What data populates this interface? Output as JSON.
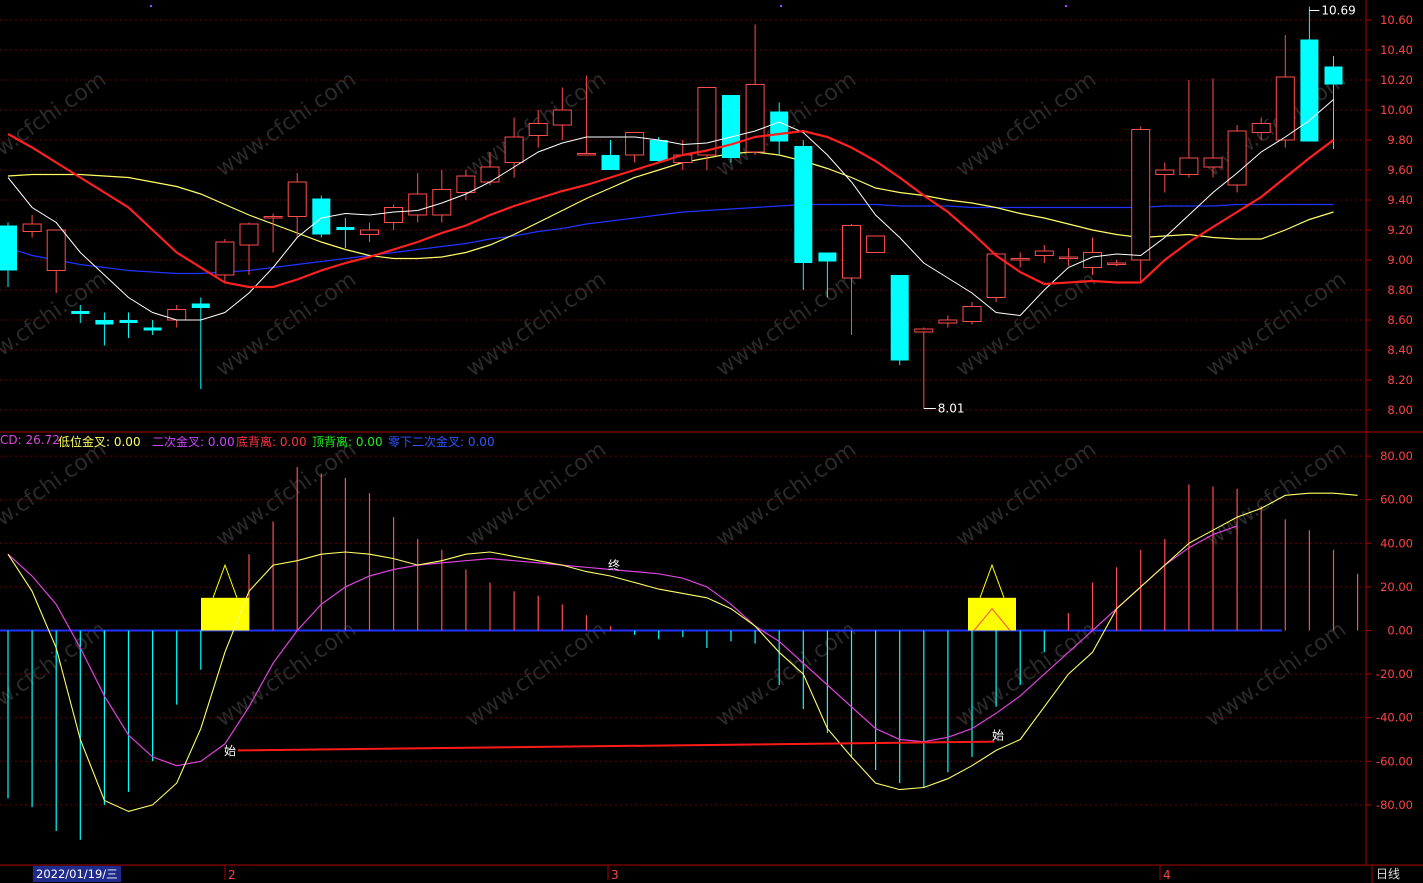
{
  "indicator": {
    "macd_label": "CD: 26.72",
    "low_cross_label": "低位金叉: 0.00",
    "second_cross_label": "二次金叉: 0.00",
    "bottom_div_label": "底背离: 0.00",
    "top_div_label": "顶背离: 0.00",
    "zero_second_cross_label": "零下二次金叉: 0.00"
  },
  "footer": {
    "date": "2022/01/19/三",
    "period": "日线",
    "month_labels": [
      "2",
      "3",
      "4"
    ]
  },
  "annotations": {
    "high": "10.69",
    "low": "8.01",
    "start": "始",
    "end": "终"
  },
  "watermark": "www.cfchi.com",
  "colors": {
    "up": "#ff4d4d",
    "down": "#00ffff",
    "ma5": "#ffffff",
    "ma10": "#ff2020",
    "ma20": "#ffff66",
    "ma60": "#2233ff",
    "dif": "#ffff66",
    "dea": "#dd44dd",
    "axis": "#aa0000",
    "signal": "#ffff00"
  },
  "chart_data": [
    {
      "type": "candlestick",
      "ylim": [
        7.95,
        10.72
      ],
      "yticks": [
        8.0,
        8.2,
        8.4,
        8.6,
        8.8,
        9.0,
        9.2,
        9.4,
        9.6,
        9.8,
        10.0,
        10.2,
        10.4,
        10.6
      ],
      "ohlc": [
        [
          9.23,
          9.25,
          8.82,
          8.93
        ],
        [
          9.19,
          9.3,
          9.15,
          9.24
        ],
        [
          8.93,
          9.2,
          8.78,
          9.2
        ],
        [
          8.66,
          8.7,
          8.58,
          8.65
        ],
        [
          8.6,
          8.65,
          8.43,
          8.57
        ],
        [
          8.6,
          8.65,
          8.48,
          8.58
        ],
        [
          8.55,
          8.6,
          8.5,
          8.53
        ],
        [
          8.6,
          8.7,
          8.55,
          8.67
        ],
        [
          8.71,
          8.75,
          8.14,
          8.68
        ],
        [
          8.9,
          9.14,
          8.85,
          9.12
        ],
        [
          9.1,
          9.25,
          8.9,
          9.24
        ],
        [
          9.28,
          9.31,
          9.05,
          9.29
        ],
        [
          9.29,
          9.58,
          9.15,
          9.52
        ],
        [
          9.41,
          9.43,
          9.15,
          9.17
        ],
        [
          9.22,
          9.28,
          9.08,
          9.2
        ],
        [
          9.17,
          9.25,
          9.12,
          9.2
        ],
        [
          9.25,
          9.37,
          9.2,
          9.35
        ],
        [
          9.3,
          9.58,
          9.25,
          9.44
        ],
        [
          9.3,
          9.6,
          9.25,
          9.47
        ],
        [
          9.45,
          9.6,
          9.4,
          9.56
        ],
        [
          9.52,
          9.72,
          9.5,
          9.62
        ],
        [
          9.65,
          9.95,
          9.55,
          9.82
        ],
        [
          9.83,
          10.0,
          9.75,
          9.91
        ],
        [
          9.9,
          10.15,
          9.8,
          10.0
        ],
        [
          9.71,
          10.23,
          9.7,
          9.71
        ],
        [
          9.7,
          9.8,
          9.6,
          9.6
        ],
        [
          9.7,
          9.8,
          9.65,
          9.85
        ],
        [
          9.8,
          9.82,
          9.65,
          9.66
        ],
        [
          9.65,
          9.8,
          9.6,
          9.7
        ],
        [
          9.7,
          10.12,
          9.6,
          10.15
        ],
        [
          10.1,
          10.1,
          9.65,
          9.68
        ],
        [
          9.72,
          10.57,
          9.7,
          10.17
        ],
        [
          9.99,
          10.05,
          9.7,
          9.79
        ],
        [
          9.76,
          9.8,
          8.8,
          8.98
        ],
        [
          9.05,
          9.05,
          8.75,
          8.99
        ],
        [
          8.88,
          9.24,
          8.5,
          9.23
        ],
        [
          9.05,
          9.15,
          9.05,
          9.16
        ],
        [
          8.9,
          8.9,
          8.3,
          8.33
        ],
        [
          8.52,
          8.55,
          8.01,
          8.54
        ],
        [
          8.58,
          8.63,
          8.55,
          8.6
        ],
        [
          8.59,
          8.72,
          8.57,
          8.69
        ],
        [
          8.75,
          9.05,
          8.72,
          9.04
        ],
        [
          9.0,
          9.05,
          8.95,
          9.01
        ],
        [
          9.03,
          9.1,
          8.98,
          9.06
        ],
        [
          9.01,
          9.08,
          8.96,
          9.02
        ],
        [
          8.95,
          9.15,
          8.9,
          9.05
        ],
        [
          8.98,
          9.0,
          8.96,
          8.98
        ],
        [
          9.0,
          9.89,
          8.85,
          9.87
        ],
        [
          9.57,
          9.65,
          9.45,
          9.6
        ],
        [
          9.57,
          10.2,
          9.55,
          9.68
        ],
        [
          9.62,
          10.21,
          9.55,
          9.68
        ],
        [
          9.5,
          9.9,
          9.45,
          9.86
        ],
        [
          9.85,
          9.95,
          9.8,
          9.91
        ],
        [
          9.8,
          10.5,
          9.75,
          10.22
        ],
        [
          10.47,
          10.69,
          9.8,
          9.79
        ],
        [
          10.29,
          10.36,
          9.74,
          10.17
        ]
      ],
      "ma5": [
        9.55,
        9.35,
        9.25,
        9.05,
        8.9,
        8.75,
        8.65,
        8.6,
        8.6,
        8.65,
        8.78,
        8.95,
        9.15,
        9.28,
        9.31,
        9.3,
        9.32,
        9.33,
        9.38,
        9.44,
        9.52,
        9.62,
        9.72,
        9.78,
        9.82,
        9.82,
        9.82,
        9.8,
        9.77,
        9.78,
        9.82,
        9.86,
        9.92,
        9.85,
        9.7,
        9.52,
        9.3,
        9.15,
        8.98,
        8.88,
        8.78,
        8.65,
        8.63,
        8.8,
        8.95,
        9.02,
        9.04,
        9.03,
        9.15,
        9.3,
        9.45,
        9.58,
        9.72,
        9.82,
        9.93,
        10.07
      ],
      "ma10": [
        9.84,
        9.75,
        9.65,
        9.55,
        9.45,
        9.35,
        9.2,
        9.05,
        8.95,
        8.85,
        8.82,
        8.82,
        8.87,
        8.93,
        8.98,
        9.02,
        9.07,
        9.12,
        9.18,
        9.23,
        9.3,
        9.36,
        9.41,
        9.46,
        9.5,
        9.55,
        9.6,
        9.65,
        9.7,
        9.73,
        9.77,
        9.82,
        9.84,
        9.86,
        9.82,
        9.75,
        9.66,
        9.55,
        9.43,
        9.32,
        9.18,
        9.03,
        8.92,
        8.84,
        8.85,
        8.86,
        8.85,
        8.85,
        9.0,
        9.12,
        9.22,
        9.32,
        9.42,
        9.55,
        9.68,
        9.8
      ],
      "ma20": [
        9.56,
        9.57,
        9.57,
        9.57,
        9.56,
        9.55,
        9.52,
        9.49,
        9.44,
        9.37,
        9.3,
        9.24,
        9.18,
        9.12,
        9.07,
        9.03,
        9.01,
        9.01,
        9.02,
        9.05,
        9.1,
        9.17,
        9.25,
        9.33,
        9.41,
        9.48,
        9.55,
        9.6,
        9.65,
        9.68,
        9.71,
        9.72,
        9.7,
        9.66,
        9.61,
        9.55,
        9.48,
        9.45,
        9.43,
        9.4,
        9.38,
        9.35,
        9.31,
        9.28,
        9.24,
        9.2,
        9.17,
        9.15,
        9.16,
        9.17,
        9.15,
        9.14,
        9.14,
        9.2,
        9.27,
        9.32
      ],
      "ma60": [
        9.08,
        9.03,
        9.0,
        8.97,
        8.95,
        8.93,
        8.92,
        8.91,
        8.91,
        8.92,
        8.93,
        8.95,
        8.97,
        8.99,
        9.01,
        9.03,
        9.05,
        9.07,
        9.09,
        9.11,
        9.14,
        9.16,
        9.19,
        9.21,
        9.24,
        9.26,
        9.28,
        9.3,
        9.32,
        9.33,
        9.34,
        9.35,
        9.36,
        9.37,
        9.37,
        9.37,
        9.37,
        9.36,
        9.36,
        9.36,
        9.35,
        9.35,
        9.35,
        9.35,
        9.35,
        9.35,
        9.35,
        9.35,
        9.36,
        9.36,
        9.36,
        9.37,
        9.37,
        9.37,
        9.37,
        9.37
      ]
    },
    {
      "type": "macd",
      "ylim": [
        -105,
        90
      ],
      "yticks": [
        80,
        60,
        40,
        20,
        0,
        -20,
        -40,
        -60,
        -80
      ],
      "ytick_labels": [
        "80.00",
        "60.00",
        "40.00",
        "20.00",
        "0.00",
        "-20.00",
        "-40.00",
        "-60.00",
        "-80.00"
      ],
      "macd_bars": [
        -77,
        -81,
        -92,
        -96,
        -80,
        -74,
        -60,
        -34,
        -18,
        14,
        35,
        50,
        75,
        72,
        70,
        63,
        52,
        42,
        37,
        28,
        22,
        18,
        16,
        12,
        7,
        2,
        -2,
        -4,
        -3,
        -8,
        -5,
        -6,
        -25,
        -36,
        -47,
        -58,
        -64,
        -70,
        -72,
        -65,
        -58,
        -35,
        -25,
        -10,
        8,
        22,
        29,
        37,
        42,
        67,
        66,
        65,
        57,
        51,
        46,
        37,
        26
      ],
      "dif": [
        35,
        18,
        -8,
        -50,
        -78,
        -83,
        -80,
        -70,
        -45,
        -10,
        18,
        30,
        32,
        35,
        36,
        35,
        33,
        30,
        32,
        35,
        36,
        34,
        32,
        30,
        27,
        25,
        22,
        19,
        17,
        15,
        10,
        2,
        -10,
        -20,
        -45,
        -58,
        -70,
        -73,
        -72,
        -68,
        -62,
        -55,
        -50,
        -35,
        -20,
        -10,
        10,
        20,
        30,
        40,
        46,
        52,
        56,
        62,
        63,
        63,
        62
      ],
      "dea": [
        35,
        25,
        12,
        -8,
        -30,
        -48,
        -58,
        -62,
        -60,
        -52,
        -35,
        -15,
        0,
        12,
        20,
        25,
        28,
        30,
        31,
        32,
        33,
        32,
        31,
        30,
        29,
        28,
        27,
        26,
        24,
        20,
        12,
        2,
        -5,
        -15,
        -25,
        -35,
        -45,
        -50,
        -51,
        -49,
        -45,
        -38,
        -30,
        -20,
        -10,
        0,
        10,
        20,
        30,
        38,
        44,
        48
      ]
    }
  ]
}
